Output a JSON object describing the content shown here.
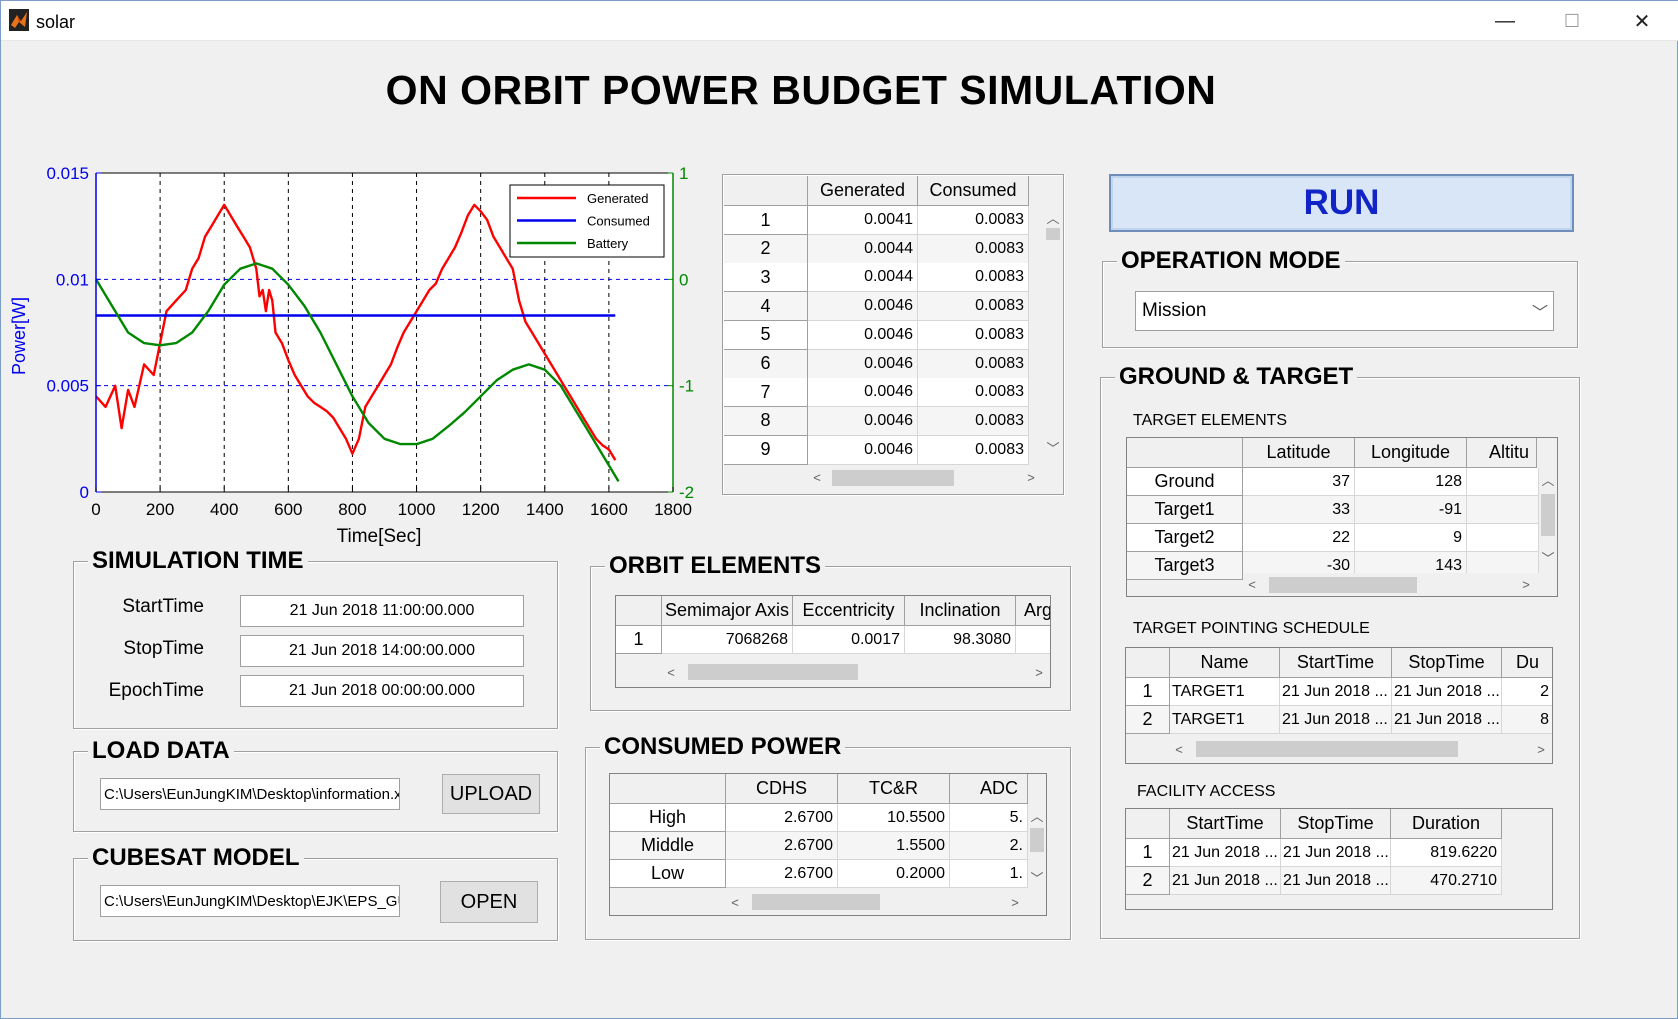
{
  "window": {
    "title": "solar",
    "minimize": "—",
    "maximize": "☐",
    "close": "✕"
  },
  "main_title": "ON ORBIT POWER BUDGET SIMULATION",
  "chart_data": {
    "type": "line",
    "xlabel": "Time[Sec]",
    "ylabel": "Power[W]",
    "xlim": [
      0,
      1800
    ],
    "ylim": [
      0,
      0.015
    ],
    "y2lim": [
      -2,
      1
    ],
    "xticks": [
      "0",
      "200",
      "400",
      "600",
      "800",
      "1000",
      "1200",
      "1400",
      "1600",
      "1800"
    ],
    "yticks": [
      "0",
      "0.005",
      "0.01",
      "0.015"
    ],
    "y2ticks": [
      "-2",
      "-1",
      "0",
      "1"
    ],
    "grid": true,
    "legend_position": "top-right",
    "series": [
      {
        "name": "Generated",
        "color": "#ff0000",
        "axis": "left",
        "x": [
          0,
          30,
          60,
          80,
          100,
          120,
          150,
          180,
          200,
          220,
          250,
          280,
          300,
          320,
          340,
          360,
          380,
          400,
          420,
          440,
          460,
          480,
          500,
          510,
          520,
          530,
          540,
          550,
          560,
          580,
          600,
          620,
          640,
          660,
          680,
          700,
          720,
          740,
          760,
          780,
          800,
          820,
          840,
          860,
          880,
          900,
          920,
          940,
          960,
          980,
          1000,
          1020,
          1040,
          1060,
          1080,
          1100,
          1120,
          1140,
          1160,
          1180,
          1200,
          1220,
          1240,
          1260,
          1280,
          1300,
          1320,
          1340,
          1360,
          1380,
          1400,
          1420,
          1440,
          1460,
          1480,
          1500,
          1520,
          1540,
          1560,
          1580,
          1600,
          1620
        ],
        "y": [
          0.0045,
          0.004,
          0.005,
          0.003,
          0.0048,
          0.004,
          0.006,
          0.0055,
          0.007,
          0.0085,
          0.009,
          0.0095,
          0.0105,
          0.011,
          0.012,
          0.0125,
          0.013,
          0.0135,
          0.013,
          0.0125,
          0.012,
          0.0115,
          0.0105,
          0.0092,
          0.0095,
          0.0085,
          0.0095,
          0.009,
          0.0075,
          0.007,
          0.0062,
          0.0055,
          0.005,
          0.0045,
          0.0042,
          0.004,
          0.0038,
          0.0035,
          0.003,
          0.0025,
          0.0018,
          0.0025,
          0.004,
          0.0045,
          0.005,
          0.0055,
          0.006,
          0.0068,
          0.0075,
          0.008,
          0.0085,
          0.009,
          0.0095,
          0.0098,
          0.0105,
          0.011,
          0.0115,
          0.0122,
          0.013,
          0.0135,
          0.0132,
          0.0128,
          0.012,
          0.0115,
          0.011,
          0.0105,
          0.009,
          0.008,
          0.0075,
          0.007,
          0.0065,
          0.006,
          0.0055,
          0.005,
          0.0045,
          0.004,
          0.0035,
          0.003,
          0.0025,
          0.0022,
          0.002,
          0.0015
        ]
      },
      {
        "name": "Consumed",
        "color": "#0000ee",
        "axis": "left",
        "x": [
          0,
          1620
        ],
        "y": [
          0.0083,
          0.0083
        ]
      },
      {
        "name": "Battery",
        "color": "#008800",
        "axis": "right",
        "x": [
          0,
          50,
          100,
          150,
          200,
          250,
          300,
          350,
          400,
          450,
          500,
          550,
          600,
          650,
          700,
          750,
          800,
          850,
          900,
          950,
          1000,
          1050,
          1100,
          1150,
          1200,
          1250,
          1300,
          1350,
          1400,
          1450,
          1500,
          1550,
          1600,
          1630
        ],
        "y": [
          0,
          -0.25,
          -0.5,
          -0.6,
          -0.62,
          -0.6,
          -0.5,
          -0.3,
          -0.05,
          0.1,
          0.15,
          0.1,
          -0.05,
          -0.25,
          -0.5,
          -0.8,
          -1.1,
          -1.35,
          -1.5,
          -1.55,
          -1.55,
          -1.5,
          -1.38,
          -1.25,
          -1.1,
          -0.95,
          -0.85,
          -0.8,
          -0.85,
          -1.0,
          -1.25,
          -1.5,
          -1.75,
          -1.9
        ]
      }
    ]
  },
  "power_table": {
    "columns": [
      "Generated",
      "Consumed"
    ],
    "rows": [
      {
        "idx": "1",
        "gen": "0.0041",
        "con": "0.0083"
      },
      {
        "idx": "2",
        "gen": "0.0044",
        "con": "0.0083"
      },
      {
        "idx": "3",
        "gen": "0.0044",
        "con": "0.0083"
      },
      {
        "idx": "4",
        "gen": "0.0046",
        "con": "0.0083"
      },
      {
        "idx": "5",
        "gen": "0.0046",
        "con": "0.0083"
      },
      {
        "idx": "6",
        "gen": "0.0046",
        "con": "0.0083"
      },
      {
        "idx": "7",
        "gen": "0.0046",
        "con": "0.0083"
      },
      {
        "idx": "8",
        "gen": "0.0046",
        "con": "0.0083"
      },
      {
        "idx": "9",
        "gen": "0.0046",
        "con": "0.0083"
      }
    ]
  },
  "run_button": "RUN",
  "operation_mode": {
    "title": "OPERATION MODE",
    "selected": "Mission"
  },
  "ground_target": {
    "title": "GROUND & TARGET",
    "target_elements": {
      "label": "TARGET ELEMENTS",
      "columns": [
        "Latitude",
        "Longitude",
        "Altitu"
      ],
      "rows": [
        {
          "name": "Ground",
          "lat": "37",
          "lon": "128"
        },
        {
          "name": "Target1",
          "lat": "33",
          "lon": "-91"
        },
        {
          "name": "Target2",
          "lat": "22",
          "lon": "9"
        },
        {
          "name": "Target3",
          "lat": "-30",
          "lon": "143"
        }
      ]
    },
    "schedule": {
      "label": "TARGET POINTING SCHEDULE",
      "columns": [
        "Name",
        "StartTime",
        "StopTime",
        "Du"
      ],
      "rows": [
        {
          "idx": "1",
          "name": "TARGET1",
          "start": "21 Jun 2018 ...",
          "stop": "21 Jun 2018 ...",
          "dur": "2"
        },
        {
          "idx": "2",
          "name": "TARGET1",
          "start": "21 Jun 2018 ...",
          "stop": "21 Jun 2018 ...",
          "dur": "8"
        }
      ]
    },
    "facility": {
      "label": "FACILITY ACCESS",
      "columns": [
        "StartTime",
        "StopTime",
        "Duration"
      ],
      "rows": [
        {
          "idx": "1",
          "start": "21 Jun 2018 ...",
          "stop": "21 Jun 2018 ...",
          "dur": "819.6220"
        },
        {
          "idx": "2",
          "start": "21 Jun 2018 ...",
          "stop": "21 Jun 2018 ...",
          "dur": "470.2710"
        }
      ]
    }
  },
  "simulation_time": {
    "title": "SIMULATION TIME",
    "start_label": "StartTime",
    "start": "21 Jun 2018 11:00:00.000",
    "stop_label": "StopTime",
    "stop": "21 Jun 2018 14:00:00.000",
    "epoch_label": "EpochTime",
    "epoch": "21 Jun 2018 00:00:00.000"
  },
  "orbit_elements": {
    "title": "ORBIT ELEMENTS",
    "columns": [
      "Semimajor Axis",
      "Eccentricity",
      "Inclination",
      "Arg"
    ],
    "row": {
      "idx": "1",
      "a": "7068268",
      "e": "0.0017",
      "i": "98.3080"
    }
  },
  "load_data": {
    "title": "LOAD DATA",
    "path": "C:\\Users\\EunJungKIM\\Desktop\\information.xl",
    "button": "UPLOAD"
  },
  "cubesat_model": {
    "title": "CUBESAT MODEL",
    "path": "C:\\Users\\EunJungKIM\\Desktop\\EJK\\EPS_GUI",
    "button": "OPEN"
  },
  "consumed_power": {
    "title": "CONSUMED POWER",
    "columns": [
      "CDHS",
      "TC&R",
      "ADC"
    ],
    "rows": [
      {
        "name": "High",
        "cdhs": "2.6700",
        "tcr": "10.5500",
        "adc": "5."
      },
      {
        "name": "Middle",
        "cdhs": "2.6700",
        "tcr": "1.5500",
        "adc": "2."
      },
      {
        "name": "Low",
        "cdhs": "2.6700",
        "tcr": "0.2000",
        "adc": "1."
      }
    ]
  },
  "icons": {
    "app": "matlab-icon",
    "scroll_up": "▲",
    "scroll_down": "▼",
    "scroll_left": "<",
    "scroll_right": ">",
    "dropdown": "chevron-down-icon"
  }
}
